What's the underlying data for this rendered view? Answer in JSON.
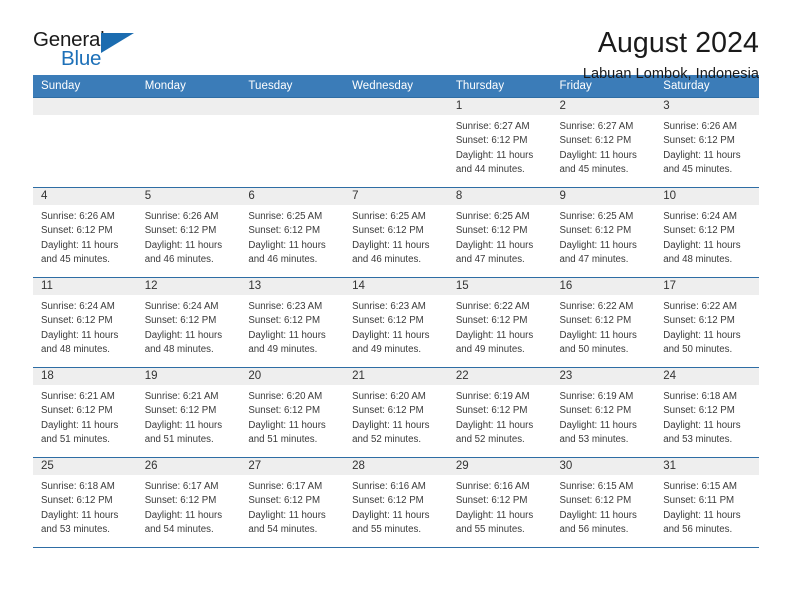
{
  "brand": {
    "name_part1": "General",
    "name_part2": "Blue",
    "triangle_color": "#1b6cb0",
    "blue_text_color": "#1d70b8"
  },
  "header": {
    "title": "August 2024",
    "subtitle": "Labuan Lombok, Indonesia"
  },
  "theme": {
    "header_row_bg": "#3b7cb8",
    "row_separator": "#2e6da4",
    "daynum_band_bg": "#eeeeee"
  },
  "weekday_headers": [
    "Sunday",
    "Monday",
    "Tuesday",
    "Wednesday",
    "Thursday",
    "Friday",
    "Saturday"
  ],
  "weeks": [
    [
      {
        "day": "",
        "sunrise": "",
        "sunset": "",
        "daylight1": "",
        "daylight2": ""
      },
      {
        "day": "",
        "sunrise": "",
        "sunset": "",
        "daylight1": "",
        "daylight2": ""
      },
      {
        "day": "",
        "sunrise": "",
        "sunset": "",
        "daylight1": "",
        "daylight2": ""
      },
      {
        "day": "",
        "sunrise": "",
        "sunset": "",
        "daylight1": "",
        "daylight2": ""
      },
      {
        "day": "1",
        "sunrise": "Sunrise: 6:27 AM",
        "sunset": "Sunset: 6:12 PM",
        "daylight1": "Daylight: 11 hours",
        "daylight2": "and 44 minutes."
      },
      {
        "day": "2",
        "sunrise": "Sunrise: 6:27 AM",
        "sunset": "Sunset: 6:12 PM",
        "daylight1": "Daylight: 11 hours",
        "daylight2": "and 45 minutes."
      },
      {
        "day": "3",
        "sunrise": "Sunrise: 6:26 AM",
        "sunset": "Sunset: 6:12 PM",
        "daylight1": "Daylight: 11 hours",
        "daylight2": "and 45 minutes."
      }
    ],
    [
      {
        "day": "4",
        "sunrise": "Sunrise: 6:26 AM",
        "sunset": "Sunset: 6:12 PM",
        "daylight1": "Daylight: 11 hours",
        "daylight2": "and 45 minutes."
      },
      {
        "day": "5",
        "sunrise": "Sunrise: 6:26 AM",
        "sunset": "Sunset: 6:12 PM",
        "daylight1": "Daylight: 11 hours",
        "daylight2": "and 46 minutes."
      },
      {
        "day": "6",
        "sunrise": "Sunrise: 6:25 AM",
        "sunset": "Sunset: 6:12 PM",
        "daylight1": "Daylight: 11 hours",
        "daylight2": "and 46 minutes."
      },
      {
        "day": "7",
        "sunrise": "Sunrise: 6:25 AM",
        "sunset": "Sunset: 6:12 PM",
        "daylight1": "Daylight: 11 hours",
        "daylight2": "and 46 minutes."
      },
      {
        "day": "8",
        "sunrise": "Sunrise: 6:25 AM",
        "sunset": "Sunset: 6:12 PM",
        "daylight1": "Daylight: 11 hours",
        "daylight2": "and 47 minutes."
      },
      {
        "day": "9",
        "sunrise": "Sunrise: 6:25 AM",
        "sunset": "Sunset: 6:12 PM",
        "daylight1": "Daylight: 11 hours",
        "daylight2": "and 47 minutes."
      },
      {
        "day": "10",
        "sunrise": "Sunrise: 6:24 AM",
        "sunset": "Sunset: 6:12 PM",
        "daylight1": "Daylight: 11 hours",
        "daylight2": "and 48 minutes."
      }
    ],
    [
      {
        "day": "11",
        "sunrise": "Sunrise: 6:24 AM",
        "sunset": "Sunset: 6:12 PM",
        "daylight1": "Daylight: 11 hours",
        "daylight2": "and 48 minutes."
      },
      {
        "day": "12",
        "sunrise": "Sunrise: 6:24 AM",
        "sunset": "Sunset: 6:12 PM",
        "daylight1": "Daylight: 11 hours",
        "daylight2": "and 48 minutes."
      },
      {
        "day": "13",
        "sunrise": "Sunrise: 6:23 AM",
        "sunset": "Sunset: 6:12 PM",
        "daylight1": "Daylight: 11 hours",
        "daylight2": "and 49 minutes."
      },
      {
        "day": "14",
        "sunrise": "Sunrise: 6:23 AM",
        "sunset": "Sunset: 6:12 PM",
        "daylight1": "Daylight: 11 hours",
        "daylight2": "and 49 minutes."
      },
      {
        "day": "15",
        "sunrise": "Sunrise: 6:22 AM",
        "sunset": "Sunset: 6:12 PM",
        "daylight1": "Daylight: 11 hours",
        "daylight2": "and 49 minutes."
      },
      {
        "day": "16",
        "sunrise": "Sunrise: 6:22 AM",
        "sunset": "Sunset: 6:12 PM",
        "daylight1": "Daylight: 11 hours",
        "daylight2": "and 50 minutes."
      },
      {
        "day": "17",
        "sunrise": "Sunrise: 6:22 AM",
        "sunset": "Sunset: 6:12 PM",
        "daylight1": "Daylight: 11 hours",
        "daylight2": "and 50 minutes."
      }
    ],
    [
      {
        "day": "18",
        "sunrise": "Sunrise: 6:21 AM",
        "sunset": "Sunset: 6:12 PM",
        "daylight1": "Daylight: 11 hours",
        "daylight2": "and 51 minutes."
      },
      {
        "day": "19",
        "sunrise": "Sunrise: 6:21 AM",
        "sunset": "Sunset: 6:12 PM",
        "daylight1": "Daylight: 11 hours",
        "daylight2": "and 51 minutes."
      },
      {
        "day": "20",
        "sunrise": "Sunrise: 6:20 AM",
        "sunset": "Sunset: 6:12 PM",
        "daylight1": "Daylight: 11 hours",
        "daylight2": "and 51 minutes."
      },
      {
        "day": "21",
        "sunrise": "Sunrise: 6:20 AM",
        "sunset": "Sunset: 6:12 PM",
        "daylight1": "Daylight: 11 hours",
        "daylight2": "and 52 minutes."
      },
      {
        "day": "22",
        "sunrise": "Sunrise: 6:19 AM",
        "sunset": "Sunset: 6:12 PM",
        "daylight1": "Daylight: 11 hours",
        "daylight2": "and 52 minutes."
      },
      {
        "day": "23",
        "sunrise": "Sunrise: 6:19 AM",
        "sunset": "Sunset: 6:12 PM",
        "daylight1": "Daylight: 11 hours",
        "daylight2": "and 53 minutes."
      },
      {
        "day": "24",
        "sunrise": "Sunrise: 6:18 AM",
        "sunset": "Sunset: 6:12 PM",
        "daylight1": "Daylight: 11 hours",
        "daylight2": "and 53 minutes."
      }
    ],
    [
      {
        "day": "25",
        "sunrise": "Sunrise: 6:18 AM",
        "sunset": "Sunset: 6:12 PM",
        "daylight1": "Daylight: 11 hours",
        "daylight2": "and 53 minutes."
      },
      {
        "day": "26",
        "sunrise": "Sunrise: 6:17 AM",
        "sunset": "Sunset: 6:12 PM",
        "daylight1": "Daylight: 11 hours",
        "daylight2": "and 54 minutes."
      },
      {
        "day": "27",
        "sunrise": "Sunrise: 6:17 AM",
        "sunset": "Sunset: 6:12 PM",
        "daylight1": "Daylight: 11 hours",
        "daylight2": "and 54 minutes."
      },
      {
        "day": "28",
        "sunrise": "Sunrise: 6:16 AM",
        "sunset": "Sunset: 6:12 PM",
        "daylight1": "Daylight: 11 hours",
        "daylight2": "and 55 minutes."
      },
      {
        "day": "29",
        "sunrise": "Sunrise: 6:16 AM",
        "sunset": "Sunset: 6:12 PM",
        "daylight1": "Daylight: 11 hours",
        "daylight2": "and 55 minutes."
      },
      {
        "day": "30",
        "sunrise": "Sunrise: 6:15 AM",
        "sunset": "Sunset: 6:12 PM",
        "daylight1": "Daylight: 11 hours",
        "daylight2": "and 56 minutes."
      },
      {
        "day": "31",
        "sunrise": "Sunrise: 6:15 AM",
        "sunset": "Sunset: 6:11 PM",
        "daylight1": "Daylight: 11 hours",
        "daylight2": "and 56 minutes."
      }
    ]
  ]
}
